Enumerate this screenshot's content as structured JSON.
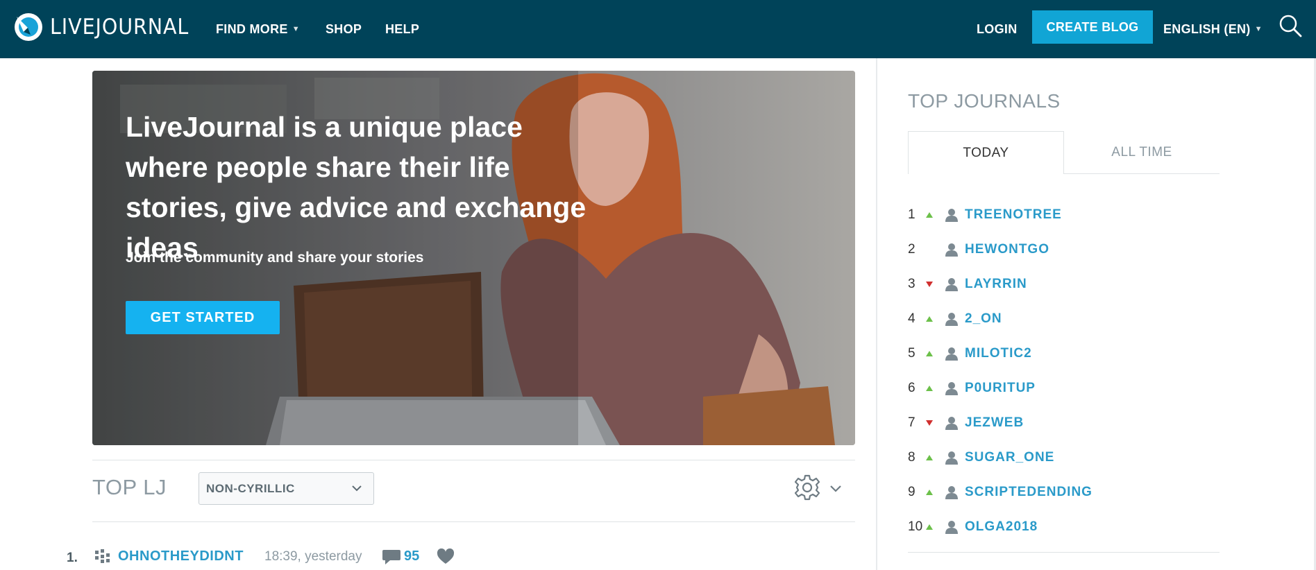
{
  "header": {
    "logo_text": "LIVEJOURNAL",
    "nav": {
      "find_more": "FIND MORE",
      "shop": "SHOP",
      "help": "HELP"
    },
    "login": "LOGIN",
    "create_blog": "CREATE BLOG",
    "language": "ENGLISH (EN)",
    "colors": {
      "bar": "#004359",
      "create_button": "#11a5d5"
    }
  },
  "hero": {
    "title": "LiveJournal is a unique place where people share their life stories, give advice and exchange ideas",
    "subtitle": "Join the community and share your stories",
    "button": "GET STARTED",
    "colors": {
      "button": "#15b2f0"
    }
  },
  "top_lj": {
    "title": "TOP LJ",
    "filter_selected": "NON-CYRILLIC",
    "posts": [
      {
        "rank": "1.",
        "user": "OHNOTHEYDIDNT",
        "time": "18:39, yesterday",
        "comments": "95"
      }
    ]
  },
  "sidebar": {
    "title": "TOP JOURNALS",
    "tabs": {
      "today": "TODAY",
      "all_time": "ALL TIME"
    },
    "journals": [
      {
        "rank": "1",
        "trend": "up",
        "name": "TREENOTREE"
      },
      {
        "rank": "2",
        "trend": "none",
        "name": "HEWONTGO"
      },
      {
        "rank": "3",
        "trend": "down",
        "name": "LAYRRIN"
      },
      {
        "rank": "4",
        "trend": "up",
        "name": "2_ON"
      },
      {
        "rank": "5",
        "trend": "up",
        "name": "MILOTIC2"
      },
      {
        "rank": "6",
        "trend": "up",
        "name": "P0URITUP"
      },
      {
        "rank": "7",
        "trend": "down",
        "name": "JEZWEB"
      },
      {
        "rank": "8",
        "trend": "up",
        "name": "SUGAR_ONE"
      },
      {
        "rank": "9",
        "trend": "up",
        "name": "SCRIPTEDENDING"
      },
      {
        "rank": "10",
        "trend": "up",
        "name": "OLGA2018"
      }
    ],
    "colors": {
      "link": "#2a9ac9",
      "trend_up": "#6cc04a",
      "trend_down": "#d0302f"
    }
  }
}
